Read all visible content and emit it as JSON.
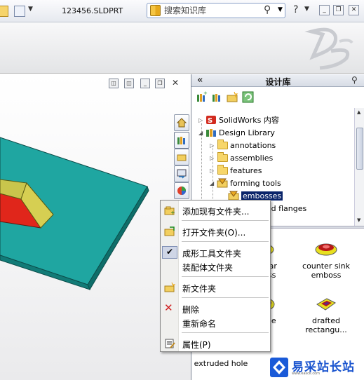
{
  "toolbar": {
    "document_title": "123456.SLDPRT",
    "search_placeholder": "搜索知识库",
    "help_glyph": "?"
  },
  "task_pane": {
    "title": "设计库",
    "collapse_glyph": "«",
    "tree": [
      {
        "label": "SolidWorks 内容"
      },
      {
        "label": "Design Library"
      },
      {
        "label": "annotations"
      },
      {
        "label": "assemblies"
      },
      {
        "label": "features"
      },
      {
        "label": "forming tools"
      },
      {
        "label": "embosses",
        "selected": true
      },
      {
        "label": "extruded flanges"
      }
    ],
    "gallery": [
      {
        "label": "...ular\n...oss"
      },
      {
        "label": "counter sink\nemboss"
      },
      {
        "label": "...ple"
      },
      {
        "label": "drafted\nrectangu..."
      },
      {
        "label": "extruded hole"
      }
    ]
  },
  "context_menu": {
    "items": [
      {
        "label": "添加现有文件夹..."
      },
      {
        "label": "打开文件夹(O)..."
      },
      {
        "label": "成形工具文件夹",
        "checked": true
      },
      {
        "label": "装配体文件夹"
      },
      {
        "label": "新文件夹"
      },
      {
        "label": "删除"
      },
      {
        "label": "重新命名"
      },
      {
        "label": "属性(P)"
      }
    ]
  },
  "watermark": {
    "text": "易采站长站",
    "sub": "www.easck.com"
  },
  "colors": {
    "plate": "#1a9e9a",
    "part_face_red": "#e0251a",
    "part_face_yellow": "#c9c24a",
    "selection": "#0a246a"
  }
}
